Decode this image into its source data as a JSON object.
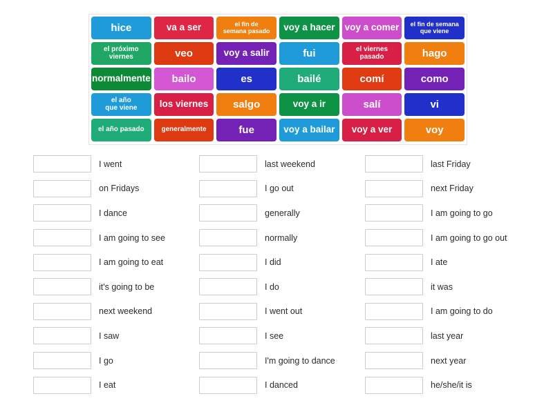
{
  "activity": {
    "type": "match-up",
    "tile_panel": {
      "rows": [
        [
          {
            "text": "hice",
            "color": "#1f9bd9",
            "size": "lg"
          },
          {
            "text": "va a ser",
            "color": "#dd2744",
            "size": "md"
          },
          {
            "text": "el fin de\nsemana pasado",
            "color": "#f07f10",
            "size": "xs"
          },
          {
            "text": "voy a hacer",
            "color": "#0e9246",
            "size": "md"
          },
          {
            "text": "voy a comer",
            "color": "#cc4ecc",
            "size": "md"
          },
          {
            "text": "el fin de semana\nque viene",
            "color": "#2130c9",
            "size": "xs"
          }
        ],
        [
          {
            "text": "el próximo\nviernes",
            "color": "#20a765",
            "size": "sm"
          },
          {
            "text": "veo",
            "color": "#dd3a12",
            "size": "lg"
          },
          {
            "text": "voy a salir",
            "color": "#7322b5",
            "size": "md"
          },
          {
            "text": "fui",
            "color": "#1f9bd9",
            "size": "lg"
          },
          {
            "text": "el viernes\npasado",
            "color": "#d81f45",
            "size": "sm"
          },
          {
            "text": "hago",
            "color": "#f07f10",
            "size": "lg"
          }
        ],
        [
          {
            "text": "normalmente",
            "color": "#0e8a37",
            "size": "md"
          },
          {
            "text": "bailo",
            "color": "#d356d3",
            "size": "lg"
          },
          {
            "text": "es",
            "color": "#2130c9",
            "size": "lg"
          },
          {
            "text": "bailé",
            "color": "#1fac78",
            "size": "lg"
          },
          {
            "text": "comí",
            "color": "#e03b12",
            "size": "lg"
          },
          {
            "text": "como",
            "color": "#7322b5",
            "size": "lg"
          }
        ],
        [
          {
            "text": "el año\nque viene",
            "color": "#1f9bd9",
            "size": "sm"
          },
          {
            "text": "los viernes",
            "color": "#d81f45",
            "size": "md"
          },
          {
            "text": "salgo",
            "color": "#f07f10",
            "size": "lg"
          },
          {
            "text": "voy a ir",
            "color": "#0e9246",
            "size": "md"
          },
          {
            "text": "salí",
            "color": "#cc4ecc",
            "size": "lg"
          },
          {
            "text": "vi",
            "color": "#2130c9",
            "size": "lg"
          }
        ],
        [
          {
            "text": "el año pasado",
            "color": "#1fac78",
            "size": "sm"
          },
          {
            "text": "generalmente",
            "color": "#dd3a12",
            "size": "sm"
          },
          {
            "text": "fue",
            "color": "#7322b5",
            "size": "lg"
          },
          {
            "text": "voy a bailar",
            "color": "#1f9bd9",
            "size": "md"
          },
          {
            "text": "voy a ver",
            "color": "#d81f45",
            "size": "md"
          },
          {
            "text": "voy",
            "color": "#f07f10",
            "size": "lg"
          }
        ]
      ]
    },
    "answers": {
      "columns": [
        {
          "items": [
            {
              "label": "I went",
              "value": ""
            },
            {
              "label": "on Fridays",
              "value": ""
            },
            {
              "label": "I dance",
              "value": ""
            },
            {
              "label": "I am going to see",
              "value": ""
            },
            {
              "label": "I am going to eat",
              "value": ""
            },
            {
              "label": "it's going to be",
              "value": ""
            },
            {
              "label": "next weekend",
              "value": ""
            },
            {
              "label": "I saw",
              "value": ""
            },
            {
              "label": "I go",
              "value": ""
            },
            {
              "label": "I eat",
              "value": ""
            }
          ]
        },
        {
          "items": [
            {
              "label": "last weekend",
              "value": ""
            },
            {
              "label": "I go out",
              "value": ""
            },
            {
              "label": "generally",
              "value": ""
            },
            {
              "label": "normally",
              "value": ""
            },
            {
              "label": "I did",
              "value": ""
            },
            {
              "label": "I do",
              "value": ""
            },
            {
              "label": "I went out",
              "value": ""
            },
            {
              "label": "I see",
              "value": ""
            },
            {
              "label": "I'm going to dance",
              "value": ""
            },
            {
              "label": "I danced",
              "value": ""
            }
          ]
        },
        {
          "items": [
            {
              "label": "last Friday",
              "value": ""
            },
            {
              "label": "next Friday",
              "value": ""
            },
            {
              "label": "I am going to go",
              "value": ""
            },
            {
              "label": "I am going to go out",
              "value": ""
            },
            {
              "label": "I ate",
              "value": ""
            },
            {
              "label": "it was",
              "value": ""
            },
            {
              "label": "I am going to do",
              "value": ""
            },
            {
              "label": "last year",
              "value": ""
            },
            {
              "label": "next year",
              "value": ""
            },
            {
              "label": "he/she/it is",
              "value": ""
            }
          ]
        }
      ]
    }
  }
}
